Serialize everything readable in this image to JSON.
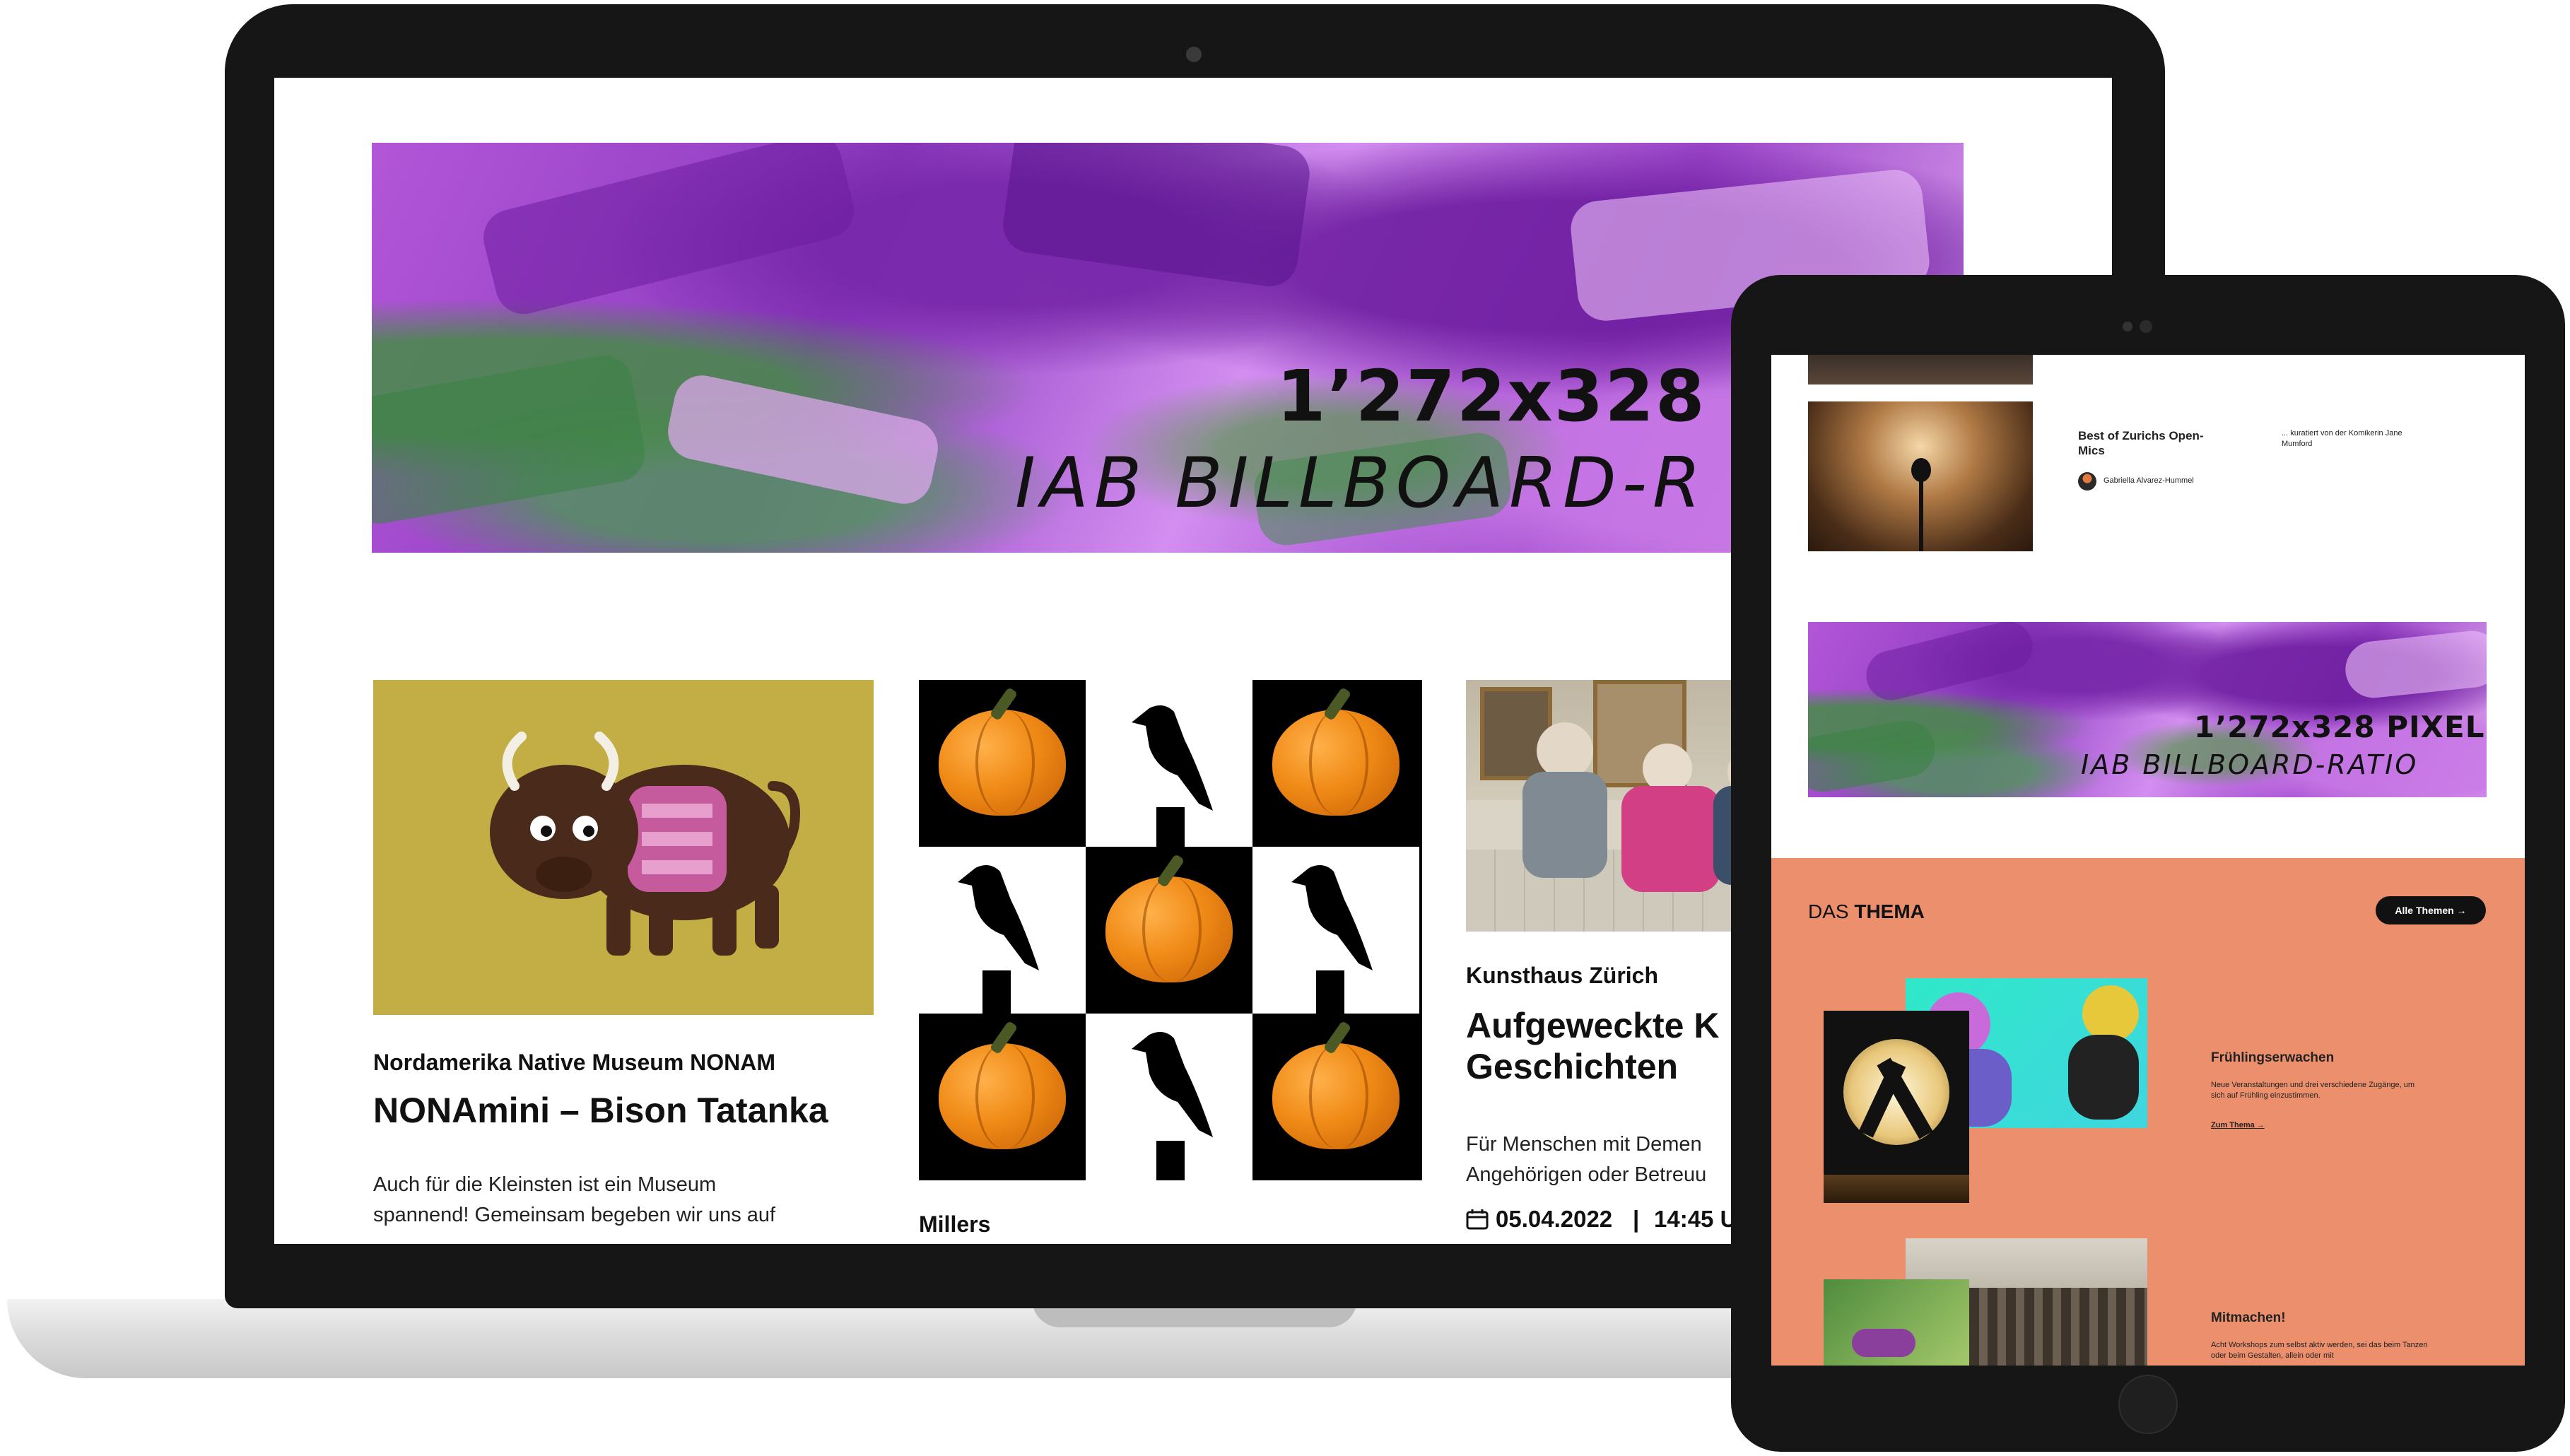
{
  "laptop": {
    "banner": {
      "headline": "1’272x328 P",
      "subline": "IAB BILLBOARD-R"
    },
    "cards": [
      {
        "venue": "Nordamerika Native Museum NONAM",
        "title": "NONAmini – Bison Tatanka",
        "description_line1": "Auch für die Kleinsten ist ein Museum",
        "description_line2": "spannend! Gemeinsam begeben wir uns auf"
      },
      {
        "venue": "Millers"
      },
      {
        "venue": "Kunsthaus Zürich",
        "title_line1": "Aufgeweckte K",
        "title_line2": "Geschichten",
        "description_line1": "Für Menschen mit Demen",
        "description_line2": "Angehörigen oder Betreuu",
        "date": "05.04.2022",
        "separator": "|",
        "time": "14:45 U"
      }
    ]
  },
  "tablet": {
    "teaser": {
      "title": "Best of Zurichs Open-Mics",
      "author": "Gabriella Alvarez-Hummel",
      "blurb": "... kuratiert von der Komikerin Jane Mumford"
    },
    "banner": {
      "headline": "1’272x328 PIXEL",
      "subline": "IAB BILLBOARD-RATIO"
    },
    "thema": {
      "label_prefix": "DAS",
      "label_bold": "THEMA",
      "button": "Alle Themen →",
      "items": [
        {
          "title": "Frühlingserwachen",
          "text": "Neue Veranstaltungen und drei verschiedene Zugänge, um sich auf Frühling einzustimmen.",
          "link": "Zum Thema →"
        },
        {
          "title": "Mitmachen!",
          "text": "Acht Workshops zum selbst aktiv werden, sei das beim Tanzen oder beim Gestalten, allein oder mit"
        }
      ]
    }
  },
  "colors": {
    "accent_orange": "#ec8f6c",
    "banner_purple": "#a94dd4",
    "bison_background": "#c3ad45",
    "device_black": "#161616"
  },
  "icons": [
    "calendar-icon",
    "arrow-right-icon",
    "avatar"
  ]
}
